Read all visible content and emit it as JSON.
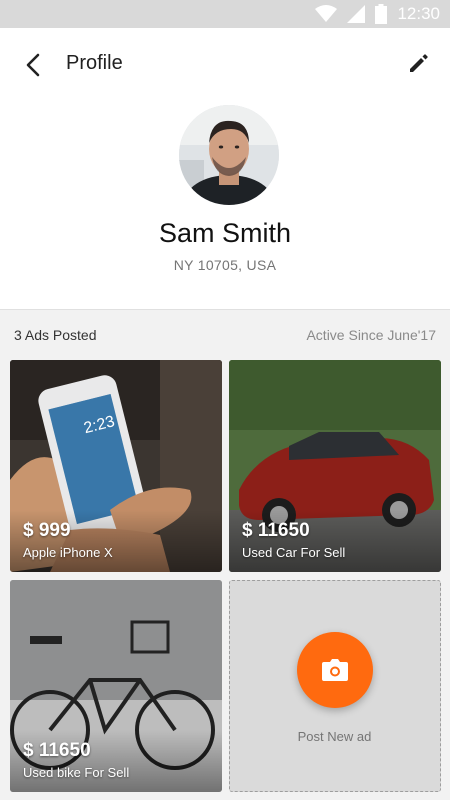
{
  "status_bar": {
    "time": "12:30"
  },
  "app_bar": {
    "title": "Profile"
  },
  "profile": {
    "name": "Sam Smith",
    "location": "NY 10705, USA"
  },
  "ads_summary": {
    "count_label": "3 Ads Posted",
    "active_since": "Active Since June'17"
  },
  "ads": [
    {
      "price": "$ 999",
      "title": "Apple iPhone X",
      "image": "phone-in-hand"
    },
    {
      "price": "$ 11650",
      "title": "Used Car For Sell",
      "image": "red-sedan"
    },
    {
      "price": "$ 11650",
      "title": "Used bike For Sell",
      "image": "black-bicycle"
    }
  ],
  "post_new": {
    "label": "Post New ad",
    "icon": "camera-icon"
  },
  "colors": {
    "accent": "#ff6a0f",
    "status_bar": "#d9d9d9"
  }
}
